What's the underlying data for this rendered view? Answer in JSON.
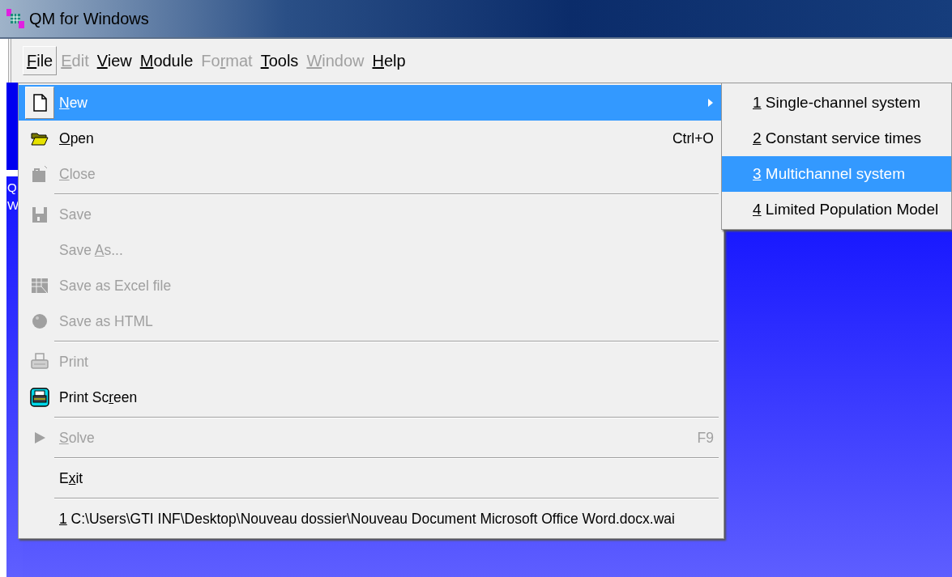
{
  "window": {
    "title": "QM for Windows"
  },
  "menubar": [
    {
      "key": "F",
      "after": "ile",
      "disabled": false,
      "selected": true
    },
    {
      "key": "E",
      "after": "dit",
      "disabled": true,
      "selected": false
    },
    {
      "key": "V",
      "after": "iew",
      "disabled": false,
      "selected": false
    },
    {
      "key": "M",
      "after": "odule",
      "disabled": false,
      "selected": false
    },
    {
      "before": "Fo",
      "key": "r",
      "after": "mat",
      "disabled": true,
      "selected": false
    },
    {
      "key": "T",
      "after": "ools",
      "disabled": false,
      "selected": false
    },
    {
      "key": "W",
      "after": "indow",
      "disabled": true,
      "selected": false
    },
    {
      "key": "H",
      "after": "elp",
      "disabled": false,
      "selected": false
    }
  ],
  "background_fragments": [
    "Q",
    "W"
  ],
  "file_menu": [
    {
      "kind": "item",
      "key": "N",
      "after": "ew",
      "disabled": false,
      "selected": true,
      "submenu": true
    },
    {
      "kind": "item",
      "key": "O",
      "after": "pen",
      "disabled": false,
      "selected": false,
      "shortcut": "Ctrl+O"
    },
    {
      "kind": "item",
      "key": "C",
      "after": "lose",
      "disabled": true,
      "selected": false
    },
    {
      "kind": "separator"
    },
    {
      "kind": "item",
      "before": "Save",
      "disabled": true,
      "selected": false
    },
    {
      "kind": "item",
      "before": "Save ",
      "key": "A",
      "after": "s...",
      "disabled": true,
      "selected": false
    },
    {
      "kind": "item",
      "before": "Save as Excel file",
      "disabled": true,
      "selected": false
    },
    {
      "kind": "item",
      "before": "Save as HTML",
      "disabled": true,
      "selected": false
    },
    {
      "kind": "separator"
    },
    {
      "kind": "item",
      "before": "Print",
      "disabled": true,
      "selected": false
    },
    {
      "kind": "item",
      "before": "Print Sc",
      "key": "r",
      "after": "een",
      "disabled": false,
      "selected": false
    },
    {
      "kind": "separator"
    },
    {
      "kind": "item",
      "key": "S",
      "after": "olve",
      "disabled": true,
      "selected": false,
      "shortcut": "F9"
    },
    {
      "kind": "separator"
    },
    {
      "kind": "item",
      "before": "E",
      "key": "x",
      "after": "it",
      "disabled": false,
      "selected": false
    },
    {
      "kind": "separator"
    },
    {
      "kind": "item",
      "key": "1",
      "after": " C:\\Users\\GTI INF\\Desktop\\Nouveau dossier\\Nouveau Document Microsoft Office Word.docx.wai",
      "disabled": false,
      "selected": false
    }
  ],
  "new_submenu": [
    {
      "key": "1",
      "after": " Single-channel system",
      "selected": false
    },
    {
      "key": "2",
      "after": " Constant service times",
      "selected": false
    },
    {
      "key": "3",
      "after": " Multichannel system",
      "selected": true
    },
    {
      "key": "4",
      "after": " Limited Population Model",
      "selected": false
    }
  ]
}
